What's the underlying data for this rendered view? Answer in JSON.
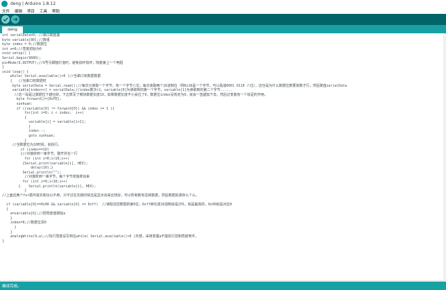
{
  "window": {
    "title": "deng | Arduino 1.8.12"
  },
  "menu": {
    "items": [
      "文件",
      "编辑",
      "项目",
      "工具",
      "帮助"
    ]
  },
  "toolbar": {
    "buttons": [
      "verify",
      "upload"
    ]
  },
  "tabs": [
    {
      "label": "deng"
    }
  ],
  "editor": {
    "lines": [
      "int serialData=0; //串口数据量",
      "byte variable[80];//数组",
      "byte index = 0;//数据位",
      "int a=0;//亮度初始为0",
      "void setup() {",
      "Serial.begin(9600);",
      "pinMode(9,OUTPUT);//9号引脚接灯泡时，避免烧坏烧坏，随着第上一个电阻",
      "}",
      "void loop() {",
      "    while( Serial.available()>0 )//当串口有数据数据",
      "    {   //当串口有数据时",
      "     byte serialData = Serial.read();//每次只读取一个字节，有一个字节八位，每次读取两个16进制位（例0x16是一个字节，可以看成0001 0110 八位），这也是为什么数据位数要高数才行，然后赋值serialData",
      "     variable[index++] = serialData;//index数次+1，variable[0]为读取到的第一个字节，variable[1]为读取到的第二个字节......",
      "      //这一段是让数据位下越也好，下边表写了哪块数据长度10，如果数据长度不小会位了0，数据位index没有定为0，就会一直越加下去，然后过变着有一个就足的作用。",
      "       byte forward[]={0xFE};",
      "       xunhuan:",
      "       if ((variable[0] != forward[0]) && index >= 1 ){",
      "           for(int i=0; i < index;  i++)",
      "           {",
      "             variable[i] = variable[i+1];",
      "             }",
      "             index--;",
      "             goto xunhuan;",
      "           }",
      "     //当数据位为10时候，就执行。",
      "         if (index==10)",
      "         {//对接收到一串字节，整齐并在一行",
      "           for (int i=0;i<10;i++)",
      "          {Serial.print(variable[i], HEX);",
      "              delay(10);}",
      "          Serial.println(\"\");",
      "           //对接收到一串字节，每个字节单独拿出来",
      "          for (int i=0;i<10;i++)",
      "        {    Serial.println(variable[i], HEX);",
      "           }",
      "//上面这两个for循环其实和功以不用，只不过在实践时候还是显示出来比较好，可以所和数有及和数据，然后数据就漫存么个么。",
      "",
      "  if (variable[8]==0x00 && variable[6] <= 0xff)  //读取这控数据的第9位，0xff转化成10进制就是255，就是最高的，0x00就是对应0",
      "  {",
      "    a=variable[6];//把亮度值赋给a",
      "    }",
      "    index=0;//数据位清0",
      "      }",
      "    }",
      "    analogWrite(9,a);//执行亮度设写到在while( Serial.available()>0 )外部，采用变量a不能执行控制亮度电平。",
      "}"
    ]
  },
  "status": {
    "text": "编译完成。"
  },
  "colors": {
    "toolbar": "#006468",
    "tabstrip": "#17a1a5",
    "accent": "#00979c",
    "button": "#7fcbcd"
  }
}
